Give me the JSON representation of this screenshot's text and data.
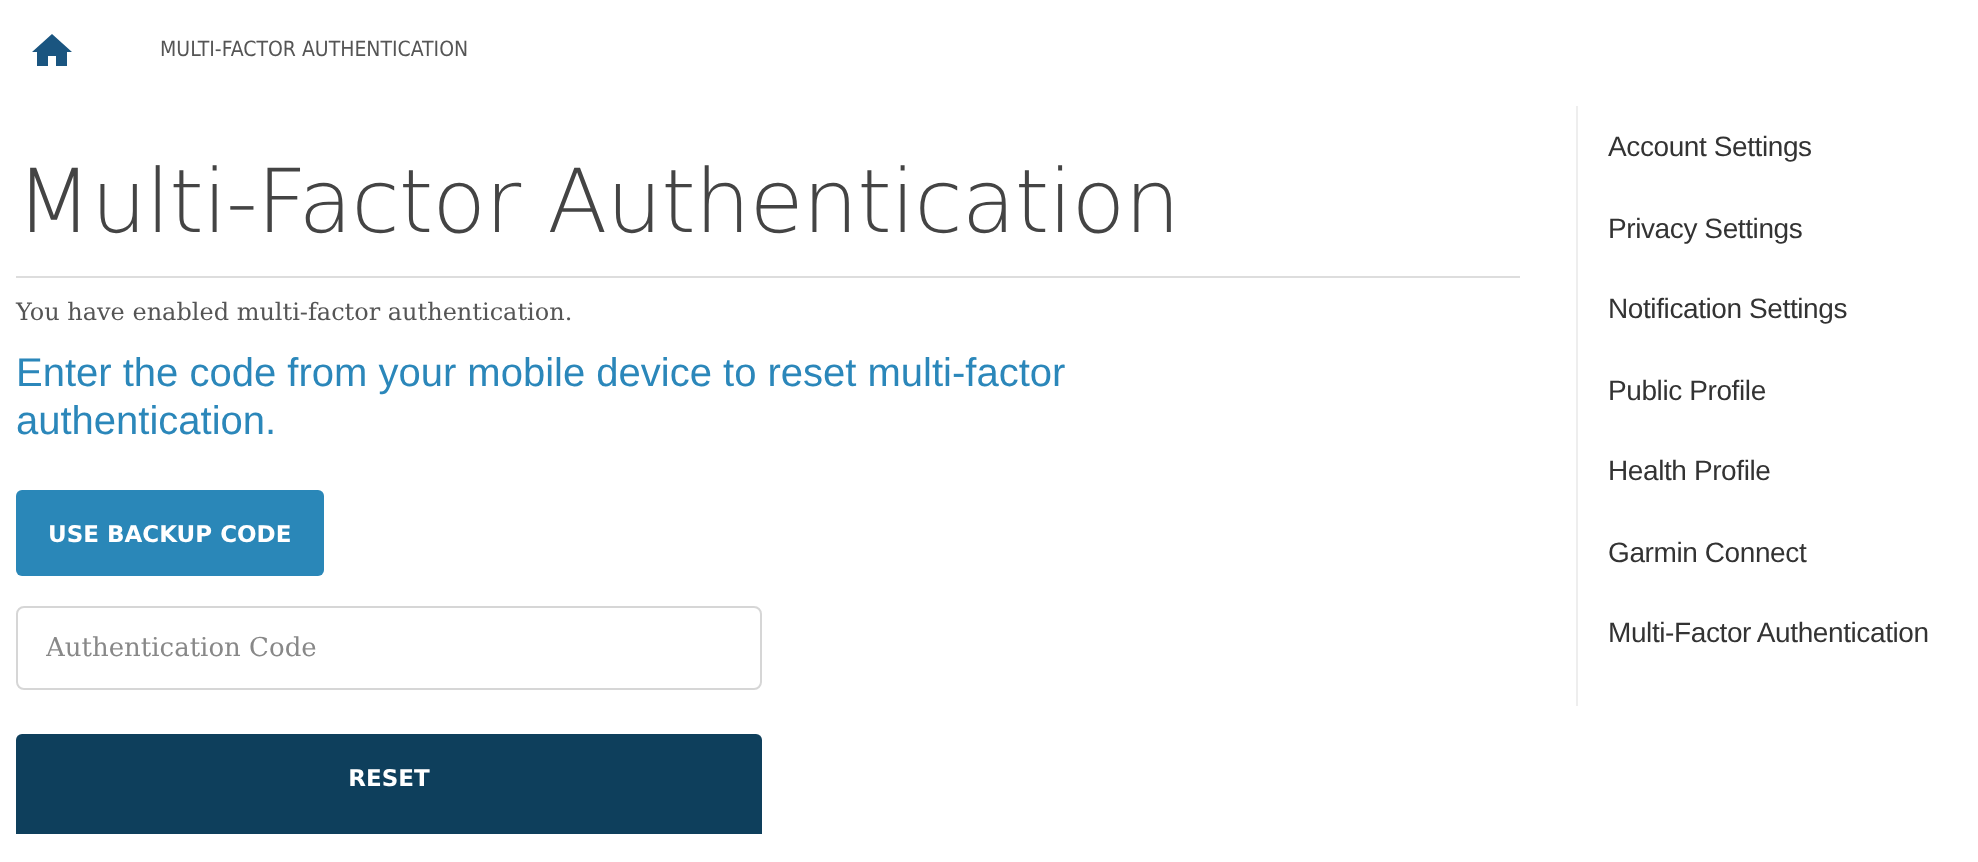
{
  "breadcrumb": {
    "current": "MULTI-FACTOR AUTHENTICATION"
  },
  "page_title": "Multi-Factor Authentication",
  "status_text": "You have enabled multi-factor authentication.",
  "instruction": "Enter the code from your mobile device to reset multi-factor authentication.",
  "backup_button": "USE BACKUP CODE",
  "code_field": {
    "placeholder": "Authentication Code"
  },
  "reset_button": "RESET",
  "sidebar": {
    "items": [
      {
        "label": "Account Settings"
      },
      {
        "label": "Privacy Settings"
      },
      {
        "label": "Notification Settings"
      },
      {
        "label": "Public Profile"
      },
      {
        "label": "Health Profile"
      },
      {
        "label": "Garmin Connect"
      },
      {
        "label": "Multi-Factor Authentication"
      }
    ]
  }
}
